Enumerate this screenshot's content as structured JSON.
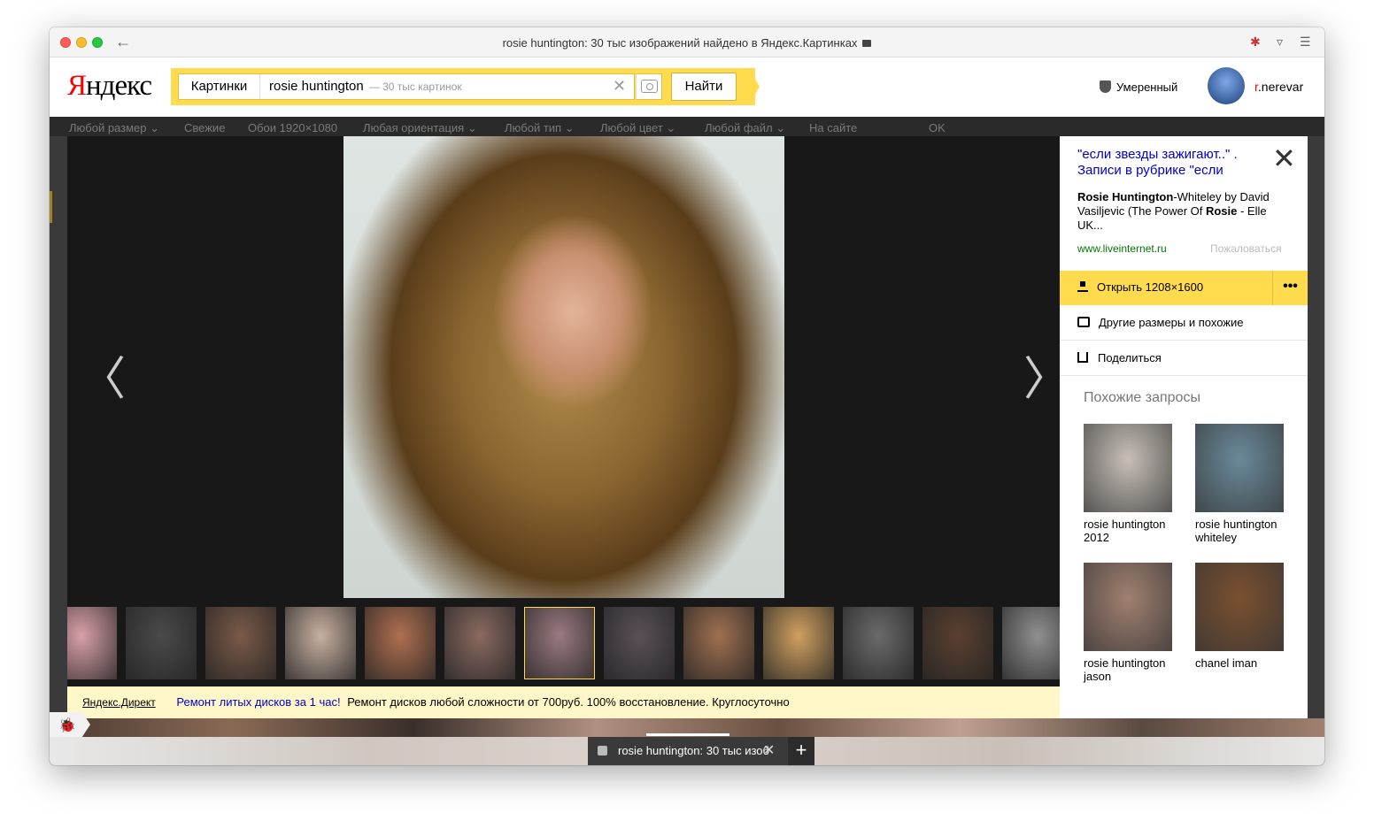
{
  "window": {
    "title": "rosie huntington: 30 тыс изображений найдено в Яндекс.Картинках"
  },
  "header": {
    "logo": {
      "first": "Я",
      "rest": "ндекс"
    },
    "search_tab": "Картинки",
    "query": "rosie huntington",
    "count": "— 30 тыс картинок",
    "find_label": "Найти",
    "moderate": "Умеренный",
    "username_first": "r",
    "username_rest": ".nerevar"
  },
  "filters": [
    "Любой размер ⌄",
    "Свежие",
    "Обои 1920×1080",
    "Любая ориентация ⌄",
    "Любой тип ⌄",
    "Любой цвет ⌄",
    "Любой файл ⌄",
    "На сайте",
    "OK"
  ],
  "viewer": {
    "prev": "〈",
    "next": "〉"
  },
  "thumbnails": [
    {
      "color": "#d9a0a8"
    },
    {
      "color": "#4a4a4a"
    },
    {
      "color": "#7a5a48"
    },
    {
      "color": "#c8b0a0"
    },
    {
      "color": "#b07050"
    },
    {
      "color": "#8a6a60"
    },
    {
      "color": "#9a7a80",
      "selected": true
    },
    {
      "color": "#5a5058"
    },
    {
      "color": "#a07050"
    },
    {
      "color": "#d0a060"
    },
    {
      "color": "#6a6a6a"
    },
    {
      "color": "#5a4030"
    },
    {
      "color": "#909090"
    }
  ],
  "ad": {
    "direct": "Яндекс.Директ",
    "link": "Ремонт литых дисков за 1 час!",
    "text": "Ремонт дисков любой сложности от 700руб. 100% восстановление. Круглосуточно"
  },
  "panel": {
    "title": "\"если звезды зажигают..\" . Записи в рубрике \"если",
    "desc_b1": "Rosie Huntington",
    "desc_1": "-Whiteley by David Vasiljevic (The Power Of ",
    "desc_b2": "Rosie",
    "desc_2": " - Elle UK...",
    "site": "www.liveinternet.ru",
    "complain": "Пожаловаться",
    "open": "Открыть 1208×1600",
    "more": "•••",
    "other_sizes": "Другие размеры и похожие",
    "share": "Поделиться",
    "similar_title": "Похожие запросы",
    "similar": [
      {
        "label": "rosie huntington 2012",
        "color": "#c8c0b8"
      },
      {
        "label": "rosie huntington whiteley",
        "color": "#6a8a9a"
      },
      {
        "label": "rosie huntington jason",
        "color": "#a08070"
      },
      {
        "label": "chanel iman",
        "color": "#7a5030"
      }
    ]
  },
  "tabbar": {
    "tab_title": "rosie huntington: 30 тыс изоб",
    "close": "✕",
    "add": "+"
  }
}
